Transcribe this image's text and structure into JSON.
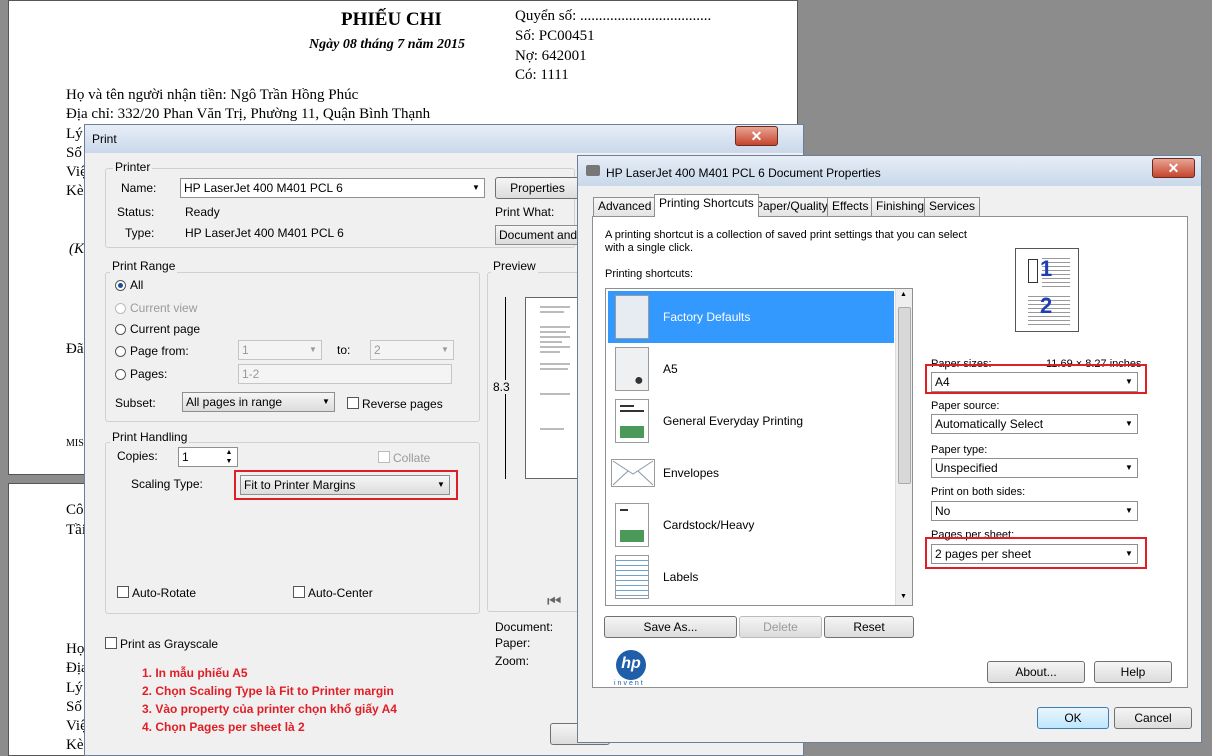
{
  "document": {
    "title": "PHIẾU CHI",
    "date": "Ngày 08 tháng 7 năm 2015",
    "quyen_so": "Quyển số: ...................................",
    "so": "Số:   PC00451",
    "no": "Nợ:    642001",
    "co": "Có:    1111",
    "ho_ten": "Họ và tên người nhận tiền: Ngô Trần Hồng Phúc",
    "dia_chi": "Địa chỉ: 332/20 Phan Văn Trị, Phường 11, Quận Bình Thạnh",
    "fragments": [
      "Lý",
      "Số",
      "Việ",
      "Kè",
      "(K",
      "Đã",
      "MIS"
    ],
    "fragments2": [
      "Côi",
      "Tầi",
      "Họ",
      "Địa",
      "Lý",
      "Số",
      "Việ",
      "Kè"
    ]
  },
  "print_dialog": {
    "title": "Print",
    "printer_group": "Printer",
    "name_label": "Name:",
    "name_value": "HP LaserJet 400 M401 PCL 6",
    "status_label": "Status:",
    "status_value": "Ready",
    "type_label": "Type:",
    "type_value": "HP LaserJet 400 M401 PCL 6",
    "properties_button": "Properties",
    "print_what_label": "Print What:",
    "print_what_value": "Document and",
    "print_range_group": "Print Range",
    "range_all": "All",
    "range_current_view": "Current view",
    "range_current_page": "Current page",
    "range_page_from": "Page from:",
    "page_from_value": "1",
    "to_label": "to:",
    "page_to_value": "2",
    "range_pages": "Pages:",
    "pages_value": "1-2",
    "subset_label": "Subset:",
    "subset_value": "All pages in range",
    "reverse_pages": "Reverse pages",
    "print_handling_group": "Print Handling",
    "copies_label": "Copies:",
    "copies_value": "1",
    "collate": "Collate",
    "scaling_label": "Scaling Type:",
    "scaling_value": "Fit to Printer Margins",
    "auto_rotate": "Auto-Rotate",
    "auto_center": "Auto-Center",
    "grayscale": "Print as Grayscale",
    "preview_label": "Preview",
    "preview_height": "8.3",
    "document_label": "Document:",
    "paper_label": "Paper:",
    "zoom_label": "Zoom:"
  },
  "instructions": [
    "1. In mẫu phiếu A5",
    "2. Chọn Scaling Type là Fit to Printer margin",
    "3. Vào property của printer chọn khổ giấy A4",
    "4. Chọn Pages per sheet là 2"
  ],
  "properties_dialog": {
    "title": "HP LaserJet 400 M401 PCL 6 Document Properties",
    "tabs": [
      "Advanced",
      "Printing Shortcuts",
      "Paper/Quality",
      "Effects",
      "Finishing",
      "Services"
    ],
    "description": "A printing shortcut is a collection of saved print settings that you can select",
    "description2": "with a single click.",
    "shortcuts_label": "Printing shortcuts:",
    "shortcuts": [
      "Factory Defaults",
      "A5",
      "General Everyday Printing",
      "Envelopes",
      "Cardstock/Heavy",
      "Labels"
    ],
    "save_as": "Save As...",
    "delete": "Delete",
    "reset": "Reset",
    "paper_sizes_label": "Paper sizes:",
    "paper_size_dims": "11.69 × 8.27 inches",
    "paper_size_value": "A4",
    "paper_source_label": "Paper source:",
    "paper_source_value": "Automatically Select",
    "paper_type_label": "Paper type:",
    "paper_type_value": "Unspecified",
    "both_sides_label": "Print on both sides:",
    "both_sides_value": "No",
    "pages_per_sheet_label": "Pages per sheet:",
    "pages_per_sheet_value": "2 pages per sheet",
    "preview_num1": "1",
    "preview_num2": "2",
    "about": "About...",
    "help": "Help",
    "ok": "OK",
    "cancel": "Cancel",
    "logo_text": "hp",
    "logo_sub": "invent"
  }
}
